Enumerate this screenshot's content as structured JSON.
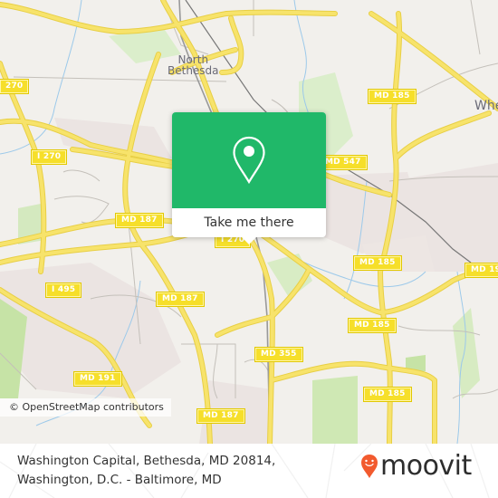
{
  "map": {
    "place_labels": [
      {
        "id": "north-bethesda",
        "lines": [
          "North",
          "Bethesda"
        ]
      },
      {
        "id": "wheaton-partial",
        "lines": [
          "Whe"
        ]
      }
    ],
    "road_shields": [
      {
        "id": "i270-left",
        "label": "270"
      },
      {
        "id": "i270",
        "label": "I 270"
      },
      {
        "id": "md187-upper",
        "label": "MD 187"
      },
      {
        "id": "md185-upper",
        "label": "MD 185"
      },
      {
        "id": "md547",
        "label": "MD 547"
      },
      {
        "id": "i495",
        "label": "I 495"
      },
      {
        "id": "md187-mid",
        "label": "MD 187"
      },
      {
        "id": "md185-mid",
        "label": "MD 185"
      },
      {
        "id": "md19x-right",
        "label": "MD 19"
      },
      {
        "id": "md185-lower",
        "label": "MD 185"
      },
      {
        "id": "md355",
        "label": "MD 355"
      },
      {
        "id": "md191",
        "label": "MD 191"
      },
      {
        "id": "md185-bottom",
        "label": "MD 185"
      },
      {
        "id": "md187-bottom",
        "label": "MD 187"
      },
      {
        "id": "i270-under-popup",
        "label": "I 270"
      }
    ],
    "attribution": "© OpenStreetMap contributors",
    "colors": {
      "background": "#f2f0ec",
      "major_road": "#f7e36b",
      "road_casing": "#e8cf45",
      "minor_road": "#b9b6b0",
      "park": "#cfe8b4",
      "water": "#9cc9ea",
      "railway": "#777777",
      "urban": "#ebe4e2"
    }
  },
  "popup": {
    "icon": "map-pin-icon",
    "cta_label": "Take me there",
    "accent": "#20b869"
  },
  "footer": {
    "address_line1": "Washington Capital, Bethesda, MD 20814,",
    "address_line2": "Washington, D.C. - Baltimore, MD",
    "brand": "moovit",
    "brand_pin_color": "#f25a2e"
  }
}
